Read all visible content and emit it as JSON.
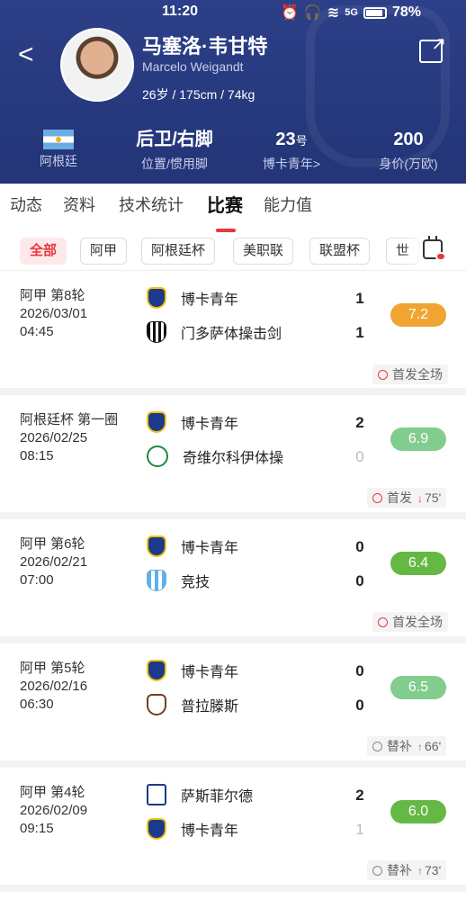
{
  "status_bar": {
    "time": "11:20",
    "signal": "5G",
    "battery": "78%"
  },
  "player": {
    "name_cn": "马塞洛·韦甘特",
    "name_en": "Marcelo Weigandt",
    "bio": "26岁 / 175cm / 74kg",
    "nationality": "阿根廷",
    "position_value": "后卫/右脚",
    "position_label": "位置/惯用脚",
    "number_value": "23",
    "number_unit": "号",
    "club_label": "博卡青年>",
    "market_value": "200",
    "market_value_label": "身价(万欧)"
  },
  "tabs": [
    "动态",
    "资料",
    "技术统计",
    "比赛",
    "能力值"
  ],
  "active_tab": "比赛",
  "filters": [
    "全部",
    "阿甲",
    "阿根廷杯",
    "美职联",
    "联盟杯",
    "世"
  ],
  "active_filter": "全部",
  "matches": [
    {
      "competition": "阿甲 第8轮",
      "date": "2026/03/01",
      "time": "04:45",
      "home": "博卡青年",
      "away": "门多萨体操击剑",
      "home_score": "1",
      "away_score": "1",
      "rating": "7.2",
      "rating_color": "#f0a431",
      "status": "首发全场",
      "minute_arrow": "",
      "minute": ""
    },
    {
      "competition": "阿根廷杯 第一圈",
      "date": "2026/02/25",
      "time": "08:15",
      "home": "博卡青年",
      "away": "奇维尔科伊体操",
      "home_score": "2",
      "away_score": "0",
      "rating": "6.9",
      "rating_color": "#82cc8d",
      "status": "首发",
      "minute_arrow": "↓",
      "minute": "75'"
    },
    {
      "competition": "阿甲 第6轮",
      "date": "2026/02/21",
      "time": "07:00",
      "home": "博卡青年",
      "away": "竞技",
      "home_score": "0",
      "away_score": "0",
      "rating": "6.4",
      "rating_color": "#66b844",
      "status": "首发全场",
      "minute_arrow": "",
      "minute": ""
    },
    {
      "competition": "阿甲 第5轮",
      "date": "2026/02/16",
      "time": "06:30",
      "home": "博卡青年",
      "away": "普拉滕斯",
      "home_score": "0",
      "away_score": "0",
      "rating": "6.5",
      "rating_color": "#82cc8d",
      "status": "替补",
      "minute_arrow": "↑",
      "minute": "66'"
    },
    {
      "competition": "阿甲 第4轮",
      "date": "2026/02/09",
      "time": "09:15",
      "home": "萨斯菲尔德",
      "away": "博卡青年",
      "home_score": "2",
      "away_score": "1",
      "rating": "6.0",
      "rating_color": "#66b844",
      "status": "替补",
      "minute_arrow": "↑",
      "minute": "73'"
    }
  ]
}
